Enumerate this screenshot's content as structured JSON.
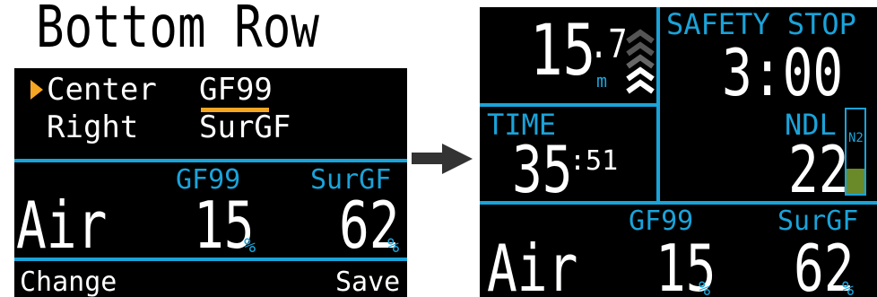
{
  "title": "Bottom Row",
  "left_screen": {
    "menu": [
      {
        "label": "Center",
        "value": "GF99",
        "selected": true
      },
      {
        "label": "Right",
        "value": "SurGF",
        "selected": false
      }
    ],
    "bottom_row": {
      "gas": "Air",
      "center_label": "GF99",
      "center_value": "15",
      "center_unit": "%",
      "right_label": "SurGF",
      "right_value": "62",
      "right_unit": "%"
    },
    "buttons": {
      "left": "Change",
      "right": "Save"
    }
  },
  "right_screen": {
    "depth_whole": "15",
    "depth_decimal": ".7",
    "depth_unit": "m",
    "safety_stop_label": "SAFETY STOP",
    "safety_stop_time": "3:00",
    "time_label": "TIME",
    "time_minutes": "35",
    "time_seconds": ":51",
    "ndl_label": "NDL",
    "ndl_value": "22",
    "n2_label": "N2",
    "n2_level_fraction": 0.3,
    "bottom_row": {
      "gas": "Air",
      "center_label": "GF99",
      "center_value": "15",
      "center_unit": "%",
      "right_label": "SurGF",
      "right_value": "62",
      "right_unit": "%"
    }
  },
  "colors": {
    "accent_blue": "#1aa3d9",
    "highlight_orange": "#f5a623",
    "n2_green": "#6a8a2a"
  }
}
